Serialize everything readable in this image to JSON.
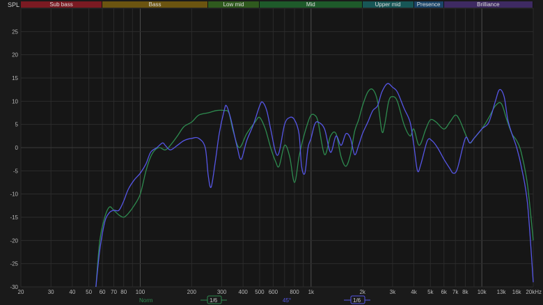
{
  "header": {
    "spl_label": "SPL"
  },
  "bands": [
    {
      "label": "Sub bass",
      "from": 20,
      "to": 60,
      "color": "#7a1a22"
    },
    {
      "label": "Bass",
      "from": 60,
      "to": 250,
      "color": "#6b5410"
    },
    {
      "label": "Low mid",
      "from": 250,
      "to": 500,
      "color": "#2f5a1e"
    },
    {
      "label": "Mid",
      "from": 500,
      "to": 2000,
      "color": "#1e5a2a"
    },
    {
      "label": "Upper mid",
      "from": 2000,
      "to": 4000,
      "color": "#175656"
    },
    {
      "label": "Presence",
      "from": 4000,
      "to": 6000,
      "color": "#1a4468"
    },
    {
      "label": "Brilliance",
      "from": 6000,
      "to": 20000,
      "color": "#3e2a62"
    }
  ],
  "legend": {
    "norm_label": "Norm",
    "norm_smoothing": "1/6",
    "deg_label": "45°",
    "deg_smoothing": "1/6"
  },
  "chart_data": {
    "type": "line",
    "xscale": "log",
    "xlim": [
      20,
      20000
    ],
    "ylim": [
      -30,
      30
    ],
    "ylabel": "SPL",
    "yticks": [
      -30,
      -25,
      -20,
      -15,
      -10,
      -5,
      0,
      5,
      10,
      15,
      20,
      25
    ],
    "xticks": [
      {
        "v": 20,
        "label": "20"
      },
      {
        "v": 30,
        "label": "30"
      },
      {
        "v": 40,
        "label": "40"
      },
      {
        "v": 50,
        "label": "50"
      },
      {
        "v": 60,
        "label": "60"
      },
      {
        "v": 70,
        "label": "70"
      },
      {
        "v": 80,
        "label": "80"
      },
      {
        "v": 100,
        "label": "100"
      },
      {
        "v": 200,
        "label": "200"
      },
      {
        "v": 300,
        "label": "300"
      },
      {
        "v": 400,
        "label": "400"
      },
      {
        "v": 500,
        "label": "500"
      },
      {
        "v": 600,
        "label": "600"
      },
      {
        "v": 800,
        "label": "800"
      },
      {
        "v": 1000,
        "label": "1k"
      },
      {
        "v": 2000,
        "label": "2k"
      },
      {
        "v": 3000,
        "label": "3k"
      },
      {
        "v": 4000,
        "label": "4k"
      },
      {
        "v": 5000,
        "label": "5k"
      },
      {
        "v": 6000,
        "label": "6k"
      },
      {
        "v": 7000,
        "label": "7k"
      },
      {
        "v": 8000,
        "label": "8k"
      },
      {
        "v": 10000,
        "label": "10k"
      },
      {
        "v": 13000,
        "label": "13k"
      },
      {
        "v": 16000,
        "label": "16k"
      },
      {
        "v": 20000,
        "label": "20kHz"
      }
    ],
    "major_x": [
      100,
      1000,
      10000
    ],
    "grid": true,
    "series": [
      {
        "name": "Norm",
        "color": "#2e8b4f",
        "points": [
          [
            55,
            -30
          ],
          [
            58,
            -20
          ],
          [
            62,
            -15
          ],
          [
            66,
            -12.8
          ],
          [
            70,
            -13.5
          ],
          [
            75,
            -14.5
          ],
          [
            80,
            -15
          ],
          [
            85,
            -14.2
          ],
          [
            92,
            -12.5
          ],
          [
            100,
            -10
          ],
          [
            108,
            -5
          ],
          [
            115,
            -2
          ],
          [
            122,
            -0.5
          ],
          [
            130,
            0
          ],
          [
            140,
            -0.5
          ],
          [
            150,
            0.5
          ],
          [
            165,
            2.5
          ],
          [
            180,
            4.5
          ],
          [
            200,
            5.5
          ],
          [
            220,
            7
          ],
          [
            250,
            7.5
          ],
          [
            280,
            8
          ],
          [
            310,
            8
          ],
          [
            330,
            7.5
          ],
          [
            350,
            3.5
          ],
          [
            380,
            0
          ],
          [
            420,
            3
          ],
          [
            470,
            5.5
          ],
          [
            500,
            6.5
          ],
          [
            540,
            4
          ],
          [
            580,
            0
          ],
          [
            620,
            -3
          ],
          [
            650,
            -4
          ],
          [
            700,
            0.5
          ],
          [
            750,
            -2
          ],
          [
            800,
            -7.5
          ],
          [
            850,
            -2
          ],
          [
            900,
            2
          ],
          [
            960,
            5.5
          ],
          [
            1000,
            7
          ],
          [
            1050,
            7
          ],
          [
            1100,
            5.5
          ],
          [
            1200,
            -1.5
          ],
          [
            1300,
            2.5
          ],
          [
            1400,
            3
          ],
          [
            1500,
            -2
          ],
          [
            1600,
            -4
          ],
          [
            1700,
            -1.5
          ],
          [
            1800,
            3.5
          ],
          [
            1900,
            6
          ],
          [
            2000,
            9
          ],
          [
            2150,
            12
          ],
          [
            2300,
            12.5
          ],
          [
            2450,
            10
          ],
          [
            2600,
            3.5
          ],
          [
            2700,
            5
          ],
          [
            2850,
            10
          ],
          [
            3000,
            11
          ],
          [
            3200,
            10
          ],
          [
            3500,
            5
          ],
          [
            3800,
            2.5
          ],
          [
            4000,
            4
          ],
          [
            4300,
            0.5
          ],
          [
            4700,
            4
          ],
          [
            5000,
            6
          ],
          [
            5400,
            5.5
          ],
          [
            6000,
            4
          ],
          [
            6500,
            5.5
          ],
          [
            7000,
            7
          ],
          [
            7400,
            6
          ],
          [
            8000,
            3
          ],
          [
            8500,
            1
          ],
          [
            9000,
            2
          ],
          [
            10000,
            4
          ],
          [
            11000,
            6.5
          ],
          [
            12000,
            9
          ],
          [
            13000,
            9.5
          ],
          [
            14000,
            6
          ],
          [
            15000,
            3
          ],
          [
            16000,
            1.5
          ],
          [
            17000,
            -1
          ],
          [
            18500,
            -8
          ],
          [
            20000,
            -20
          ]
        ]
      },
      {
        "name": "45°",
        "color": "#5656e6",
        "points": [
          [
            55,
            -30
          ],
          [
            58,
            -22
          ],
          [
            62,
            -16
          ],
          [
            66,
            -14
          ],
          [
            70,
            -13.5
          ],
          [
            75,
            -13.5
          ],
          [
            80,
            -11.5
          ],
          [
            85,
            -9
          ],
          [
            92,
            -7
          ],
          [
            100,
            -5.5
          ],
          [
            108,
            -3.5
          ],
          [
            115,
            -1
          ],
          [
            125,
            0
          ],
          [
            135,
            1
          ],
          [
            140,
            0.5
          ],
          [
            150,
            -0.5
          ],
          [
            165,
            0.5
          ],
          [
            180,
            1.5
          ],
          [
            200,
            2
          ],
          [
            220,
            2
          ],
          [
            240,
            0
          ],
          [
            250,
            -6
          ],
          [
            260,
            -8.5
          ],
          [
            275,
            -3
          ],
          [
            290,
            3
          ],
          [
            310,
            8
          ],
          [
            320,
            9
          ],
          [
            340,
            6
          ],
          [
            370,
            0
          ],
          [
            390,
            -2.5
          ],
          [
            420,
            1.5
          ],
          [
            460,
            5
          ],
          [
            500,
            9
          ],
          [
            520,
            9.8
          ],
          [
            550,
            8
          ],
          [
            580,
            4
          ],
          [
            620,
            -1
          ],
          [
            650,
            -1
          ],
          [
            700,
            5
          ],
          [
            750,
            6.5
          ],
          [
            800,
            6
          ],
          [
            850,
            3
          ],
          [
            880,
            -4
          ],
          [
            920,
            -5.5
          ],
          [
            960,
            0
          ],
          [
            1000,
            2
          ],
          [
            1050,
            5
          ],
          [
            1100,
            5.5
          ],
          [
            1200,
            4
          ],
          [
            1300,
            -1
          ],
          [
            1400,
            2.5
          ],
          [
            1500,
            0.5
          ],
          [
            1600,
            3
          ],
          [
            1700,
            2
          ],
          [
            1800,
            -1.5
          ],
          [
            1900,
            0.5
          ],
          [
            2000,
            3
          ],
          [
            2150,
            5.5
          ],
          [
            2300,
            8
          ],
          [
            2450,
            9
          ],
          [
            2600,
            12
          ],
          [
            2800,
            13.8
          ],
          [
            3000,
            13
          ],
          [
            3200,
            12
          ],
          [
            3500,
            8.5
          ],
          [
            3800,
            5.5
          ],
          [
            4000,
            0.5
          ],
          [
            4200,
            -5
          ],
          [
            4400,
            -3.5
          ],
          [
            4800,
            1.5
          ],
          [
            5100,
            1.5
          ],
          [
            5500,
            0
          ],
          [
            6000,
            -2.5
          ],
          [
            6500,
            -4.5
          ],
          [
            6800,
            -5.5
          ],
          [
            7200,
            -4.5
          ],
          [
            8000,
            2
          ],
          [
            8500,
            1
          ],
          [
            9000,
            2
          ],
          [
            10000,
            4
          ],
          [
            11000,
            5.5
          ],
          [
            12000,
            10
          ],
          [
            12700,
            12.5
          ],
          [
            13500,
            11
          ],
          [
            14200,
            6
          ],
          [
            15000,
            3
          ],
          [
            16000,
            0
          ],
          [
            17000,
            -4
          ],
          [
            18500,
            -12
          ],
          [
            20000,
            -29
          ]
        ]
      }
    ]
  }
}
